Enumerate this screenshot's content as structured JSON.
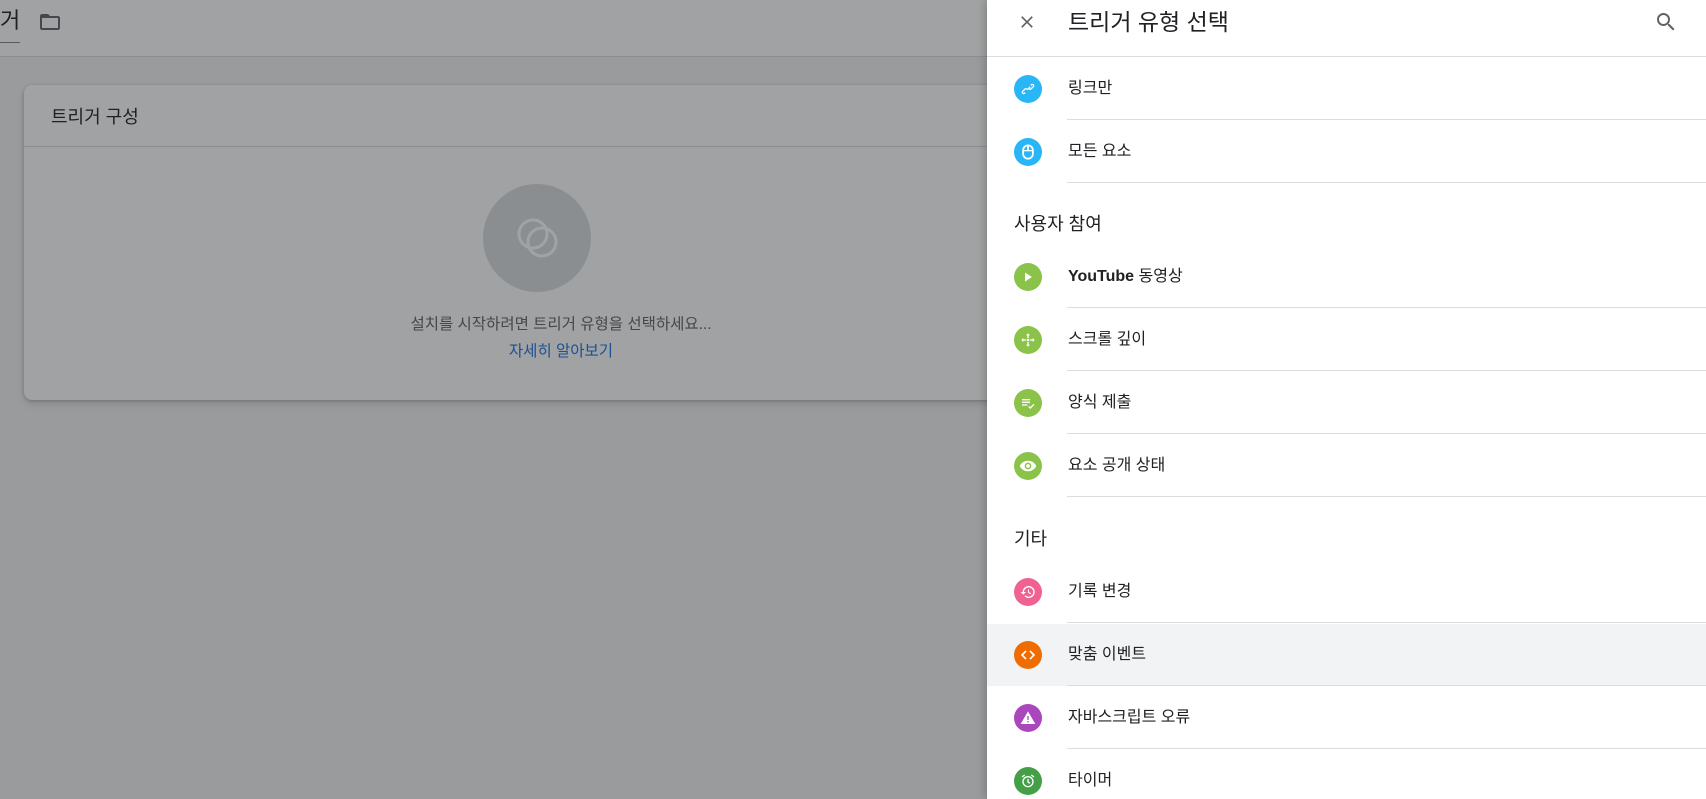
{
  "background": {
    "title_fragment": "거",
    "card_title": "트리거 구성",
    "hint": "설치를 시작하려면 트리거 유형을 선택하세요...",
    "learn_more": "자세히 알아보기"
  },
  "sheet": {
    "title": "트리거 유형 선택",
    "top_items": [
      {
        "label": "링크만",
        "icon": "link-icon",
        "color": "#29b6f6"
      },
      {
        "label": "모든 요소",
        "icon": "mouse-icon",
        "color": "#29b6f6"
      }
    ],
    "sections": [
      {
        "header": "사용자 참여",
        "items": [
          {
            "label_bold": "YouTube",
            "label": " 동영상",
            "icon": "play-icon",
            "color": "#8bc34a"
          },
          {
            "label": "스크롤 깊이",
            "icon": "move-icon",
            "color": "#8bc34a"
          },
          {
            "label": "양식 제출",
            "icon": "form-check-icon",
            "color": "#8bc34a"
          },
          {
            "label": "요소 공개 상태",
            "icon": "eye-icon",
            "color": "#8bc34a"
          }
        ]
      },
      {
        "header": "기타",
        "items": [
          {
            "label": "기록 변경",
            "icon": "history-icon",
            "color": "#f06292"
          },
          {
            "label": "맞춤 이벤트",
            "icon": "code-icon",
            "color": "#ef6c00"
          },
          {
            "label": "자바스크립트 오류",
            "icon": "warning-icon",
            "color": "#ab47bc"
          },
          {
            "label": "타이머",
            "icon": "alarm-icon",
            "color": "#43a047"
          }
        ]
      }
    ]
  }
}
